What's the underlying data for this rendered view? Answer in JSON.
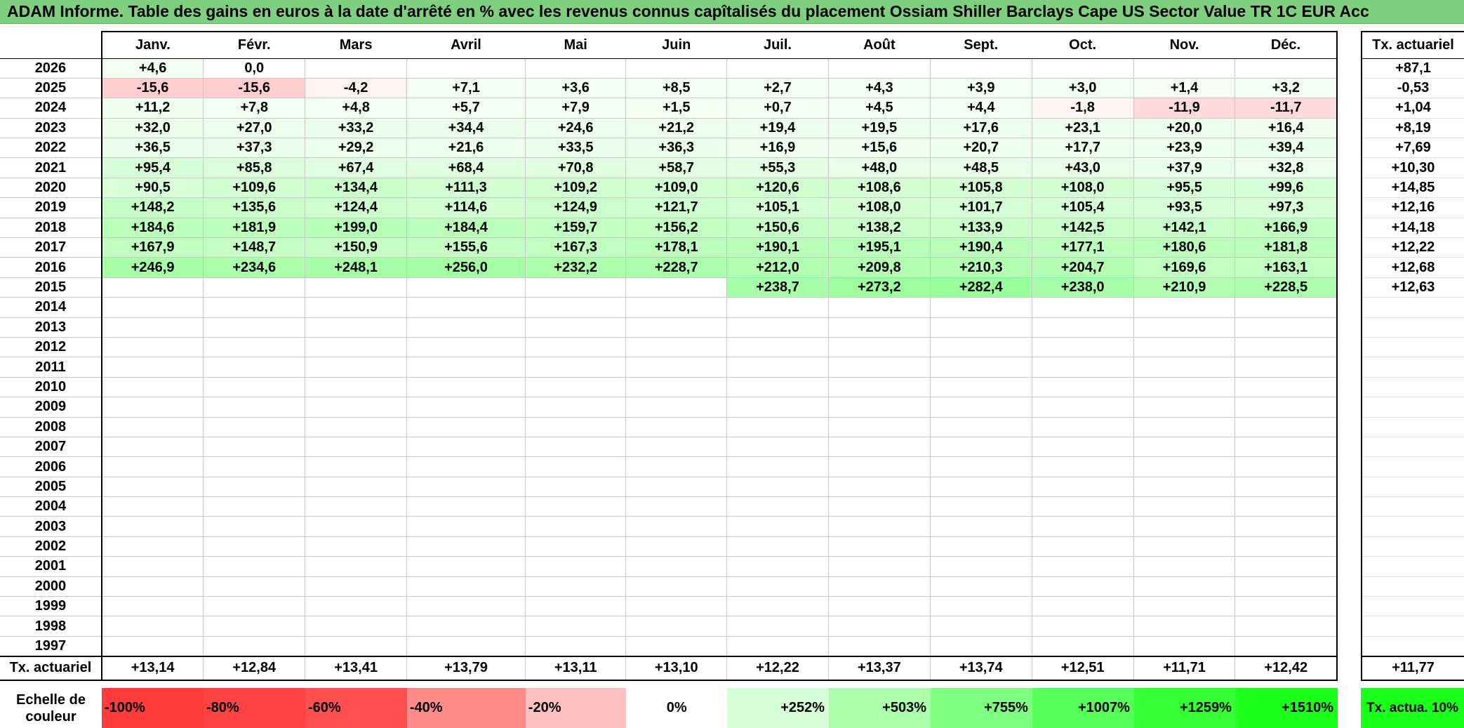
{
  "title": "ADAM Informe. Table des gains en euros à la date d'arrêté en % avec les revenus connus capîtalisés du placement Ossiam Shiller Barclays Cape US Sector Value TR 1C EUR Acc",
  "months": [
    "Janv.",
    "Févr.",
    "Mars",
    "Avril",
    "Mai",
    "Juin",
    "Juil.",
    "Août",
    "Sept.",
    "Oct.",
    "Nov.",
    "Déc."
  ],
  "side_header": "Tx. actuariel",
  "rows": [
    {
      "year": "2026",
      "values": [
        "+4,6",
        "0,0",
        "",
        "",
        "",
        "",
        "",
        "",
        "",
        "",
        "",
        ""
      ],
      "rate": "+87,1"
    },
    {
      "year": "2025",
      "values": [
        "-15,6",
        "-15,6",
        "-4,2",
        "+7,1",
        "+3,6",
        "+8,5",
        "+2,7",
        "+4,3",
        "+3,9",
        "+3,0",
        "+1,4",
        "+3,2"
      ],
      "rate": "-0,53"
    },
    {
      "year": "2024",
      "values": [
        "+11,2",
        "+7,8",
        "+4,8",
        "+5,7",
        "+7,9",
        "+1,5",
        "+0,7",
        "+4,5",
        "+4,4",
        "-1,8",
        "-11,9",
        "-11,7"
      ],
      "rate": "+1,04"
    },
    {
      "year": "2023",
      "values": [
        "+32,0",
        "+27,0",
        "+33,2",
        "+34,4",
        "+24,6",
        "+21,2",
        "+19,4",
        "+19,5",
        "+17,6",
        "+23,1",
        "+20,0",
        "+16,4"
      ],
      "rate": "+8,19"
    },
    {
      "year": "2022",
      "values": [
        "+36,5",
        "+37,3",
        "+29,2",
        "+21,6",
        "+33,5",
        "+36,3",
        "+16,9",
        "+15,6",
        "+20,7",
        "+17,7",
        "+23,9",
        "+39,4"
      ],
      "rate": "+7,69"
    },
    {
      "year": "2021",
      "values": [
        "+95,4",
        "+85,8",
        "+67,4",
        "+68,4",
        "+70,8",
        "+58,7",
        "+55,3",
        "+48,0",
        "+48,5",
        "+43,0",
        "+37,9",
        "+32,8"
      ],
      "rate": "+10,30"
    },
    {
      "year": "2020",
      "values": [
        "+90,5",
        "+109,6",
        "+134,4",
        "+111,3",
        "+109,2",
        "+109,0",
        "+120,6",
        "+108,6",
        "+105,8",
        "+108,0",
        "+95,5",
        "+99,6"
      ],
      "rate": "+14,85"
    },
    {
      "year": "2019",
      "values": [
        "+148,2",
        "+135,6",
        "+124,4",
        "+114,6",
        "+124,9",
        "+121,7",
        "+105,1",
        "+108,0",
        "+101,7",
        "+105,4",
        "+93,5",
        "+97,3"
      ],
      "rate": "+12,16"
    },
    {
      "year": "2018",
      "values": [
        "+184,6",
        "+181,9",
        "+199,0",
        "+184,4",
        "+159,7",
        "+156,2",
        "+150,6",
        "+138,2",
        "+133,9",
        "+142,5",
        "+142,1",
        "+166,9"
      ],
      "rate": "+14,18"
    },
    {
      "year": "2017",
      "values": [
        "+167,9",
        "+148,7",
        "+150,9",
        "+155,6",
        "+167,3",
        "+178,1",
        "+190,1",
        "+195,1",
        "+190,4",
        "+177,1",
        "+180,6",
        "+181,8"
      ],
      "rate": "+12,22"
    },
    {
      "year": "2016",
      "values": [
        "+246,9",
        "+234,6",
        "+248,1",
        "+256,0",
        "+232,2",
        "+228,7",
        "+212,0",
        "+209,8",
        "+210,3",
        "+204,7",
        "+169,6",
        "+163,1"
      ],
      "rate": "+12,68"
    },
    {
      "year": "2015",
      "values": [
        "",
        "",
        "",
        "",
        "",
        "",
        "+238,7",
        "+273,2",
        "+282,4",
        "+238,0",
        "+210,9",
        "+228,5"
      ],
      "rate": "+12,63"
    },
    {
      "year": "2014",
      "values": [
        "",
        "",
        "",
        "",
        "",
        "",
        "",
        "",
        "",
        "",
        "",
        ""
      ],
      "rate": ""
    },
    {
      "year": "2013",
      "values": [
        "",
        "",
        "",
        "",
        "",
        "",
        "",
        "",
        "",
        "",
        "",
        ""
      ],
      "rate": ""
    },
    {
      "year": "2012",
      "values": [
        "",
        "",
        "",
        "",
        "",
        "",
        "",
        "",
        "",
        "",
        "",
        ""
      ],
      "rate": ""
    },
    {
      "year": "2011",
      "values": [
        "",
        "",
        "",
        "",
        "",
        "",
        "",
        "",
        "",
        "",
        "",
        ""
      ],
      "rate": ""
    },
    {
      "year": "2010",
      "values": [
        "",
        "",
        "",
        "",
        "",
        "",
        "",
        "",
        "",
        "",
        "",
        ""
      ],
      "rate": ""
    },
    {
      "year": "2009",
      "values": [
        "",
        "",
        "",
        "",
        "",
        "",
        "",
        "",
        "",
        "",
        "",
        ""
      ],
      "rate": ""
    },
    {
      "year": "2008",
      "values": [
        "",
        "",
        "",
        "",
        "",
        "",
        "",
        "",
        "",
        "",
        "",
        ""
      ],
      "rate": ""
    },
    {
      "year": "2007",
      "values": [
        "",
        "",
        "",
        "",
        "",
        "",
        "",
        "",
        "",
        "",
        "",
        ""
      ],
      "rate": ""
    },
    {
      "year": "2006",
      "values": [
        "",
        "",
        "",
        "",
        "",
        "",
        "",
        "",
        "",
        "",
        "",
        ""
      ],
      "rate": ""
    },
    {
      "year": "2005",
      "values": [
        "",
        "",
        "",
        "",
        "",
        "",
        "",
        "",
        "",
        "",
        "",
        ""
      ],
      "rate": ""
    },
    {
      "year": "2004",
      "values": [
        "",
        "",
        "",
        "",
        "",
        "",
        "",
        "",
        "",
        "",
        "",
        ""
      ],
      "rate": ""
    },
    {
      "year": "2003",
      "values": [
        "",
        "",
        "",
        "",
        "",
        "",
        "",
        "",
        "",
        "",
        "",
        ""
      ],
      "rate": ""
    },
    {
      "year": "2002",
      "values": [
        "",
        "",
        "",
        "",
        "",
        "",
        "",
        "",
        "",
        "",
        "",
        ""
      ],
      "rate": ""
    },
    {
      "year": "2001",
      "values": [
        "",
        "",
        "",
        "",
        "",
        "",
        "",
        "",
        "",
        "",
        "",
        ""
      ],
      "rate": ""
    },
    {
      "year": "2000",
      "values": [
        "",
        "",
        "",
        "",
        "",
        "",
        "",
        "",
        "",
        "",
        "",
        ""
      ],
      "rate": ""
    },
    {
      "year": "1999",
      "values": [
        "",
        "",
        "",
        "",
        "",
        "",
        "",
        "",
        "",
        "",
        "",
        ""
      ],
      "rate": ""
    },
    {
      "year": "1998",
      "values": [
        "",
        "",
        "",
        "",
        "",
        "",
        "",
        "",
        "",
        "",
        "",
        ""
      ],
      "rate": ""
    },
    {
      "year": "1997",
      "values": [
        "",
        "",
        "",
        "",
        "",
        "",
        "",
        "",
        "",
        "",
        "",
        ""
      ],
      "rate": ""
    }
  ],
  "footer": {
    "label": "Tx. actuariel",
    "values": [
      "+13,14",
      "+12,84",
      "+13,41",
      "+13,79",
      "+13,11",
      "+13,10",
      "+12,22",
      "+13,37",
      "+13,74",
      "+12,51",
      "+11,71",
      "+12,42"
    ],
    "rate": "+11,77"
  },
  "scale": {
    "label": "Echelle de couleur",
    "items": [
      {
        "text": "-100%",
        "color": "#ff3b3b",
        "align": "neg"
      },
      {
        "text": "-80%",
        "color": "#ff4343",
        "align": "neg"
      },
      {
        "text": "-60%",
        "color": "#ff4f4f",
        "align": "neg"
      },
      {
        "text": "-40%",
        "color": "#ff8a8a",
        "align": "neg"
      },
      {
        "text": "-20%",
        "color": "#ffc0c0",
        "align": "neg"
      },
      {
        "text": "0%",
        "color": "#ffffff",
        "align": "zero"
      },
      {
        "text": "+252%",
        "color": "#d7ffd7",
        "align": "pos"
      },
      {
        "text": "+503%",
        "color": "#aaffaa",
        "align": "pos"
      },
      {
        "text": "+755%",
        "color": "#7fff7f",
        "align": "pos"
      },
      {
        "text": "+1007%",
        "color": "#55ff55",
        "align": "pos"
      },
      {
        "text": "+1259%",
        "color": "#33ff33",
        "align": "pos"
      },
      {
        "text": "+1510%",
        "color": "#1bff1b",
        "align": "pos"
      }
    ],
    "side_label": "Tx. actua. 10%",
    "side_color": "#1bff1b"
  }
}
